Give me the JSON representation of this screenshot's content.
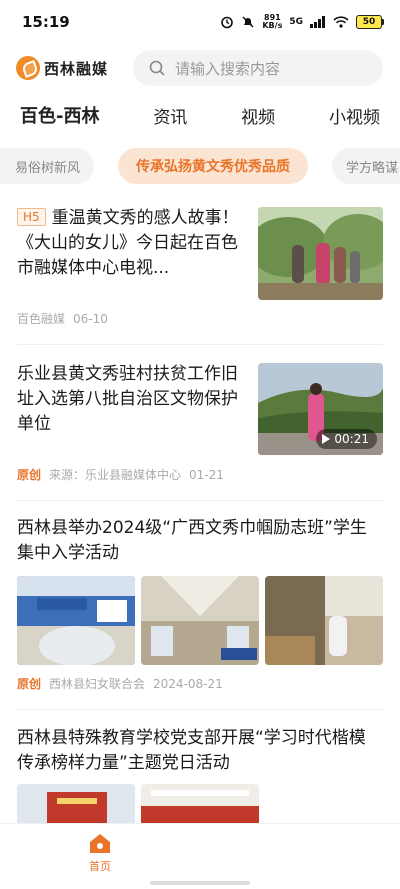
{
  "status_bar": {
    "time": "15:19",
    "net_speed_value": "891",
    "net_speed_unit": "KB/s",
    "signal_label": "5G",
    "battery": "50"
  },
  "header": {
    "logo_text": "西林融媒",
    "search_placeholder": "请输入搜索内容"
  },
  "tabs": [
    {
      "label": "百色-西林",
      "active": true
    },
    {
      "label": "资讯",
      "active": false
    },
    {
      "label": "视频",
      "active": false
    },
    {
      "label": "小视频",
      "active": false
    }
  ],
  "chips": [
    {
      "label": "易俗树新风"
    },
    {
      "label": "传承弘扬黄文秀优秀品质",
      "active": true
    },
    {
      "label": "学方略谋"
    }
  ],
  "news": [
    {
      "tag": "H5",
      "title": "重温黄文秀的感人故事！《大山的女儿》今日起在百色市融媒体中心电视...",
      "source": "百色融媒",
      "date": "06-10"
    },
    {
      "title": "乐业县黄文秀驻村扶贫工作旧址入选第八批自治区文物保护单位",
      "origin": "原创",
      "source": "来源：乐业县融媒体中心",
      "date": "01-21",
      "video_duration": "00:21"
    },
    {
      "title": "西林县举办2024级“广西文秀巾帼励志班”学生集中入学活动",
      "origin": "原创",
      "source": "西林县妇女联合会",
      "date": "2024-08-21"
    },
    {
      "title": "西林县特殊教育学校党支部开展“学习时代楷模 传承榜样力量”主题党日活动"
    }
  ],
  "bottom_nav": {
    "home_label": "首页"
  },
  "colors": {
    "accent": "#e9742a",
    "chip_active_bg": "#fbe5d2"
  }
}
